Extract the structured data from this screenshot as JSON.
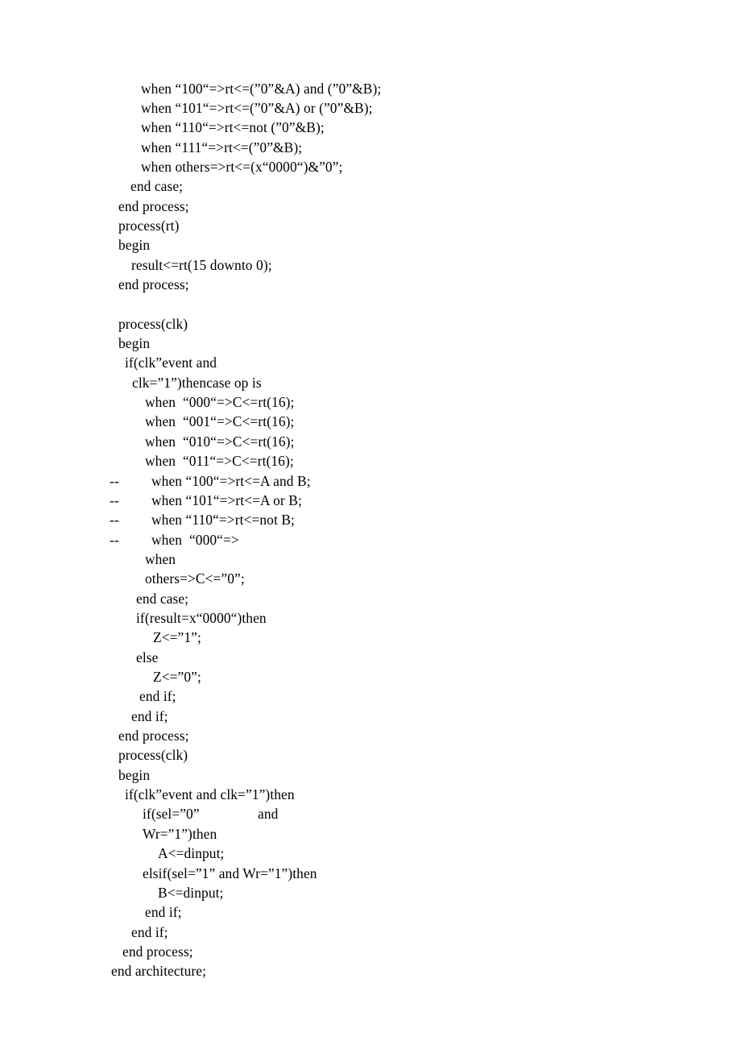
{
  "document": {
    "type": "vhdl-source-listing",
    "page_background": "#ffffff",
    "text_color": "#000000",
    "lines": [
      {
        "indent": 175,
        "text": "when “100“=>rt<=(”0”&A) and (”0”&B);"
      },
      {
        "indent": 175,
        "text": "when “101“=>rt<=(”0”&A) or (”0”&B);"
      },
      {
        "indent": 175,
        "text": "when “110“=>rt<=not (”0”&B);"
      },
      {
        "indent": 175,
        "text": "when “111“=>rt<=(”0”&B);"
      },
      {
        "indent": 175,
        "text": "when others=>rt<=(x“0000“)&”0”;"
      },
      {
        "indent": 162,
        "text": "end case;"
      },
      {
        "indent": 147,
        "text": "end process;"
      },
      {
        "indent": 147,
        "text": "process(rt)"
      },
      {
        "indent": 147,
        "text": "begin"
      },
      {
        "indent": 163,
        "text": "result<=rt(15 downto 0);"
      },
      {
        "indent": 147,
        "text": "end process;"
      },
      {
        "blank": true
      },
      {
        "indent": 147,
        "text": "process(clk)"
      },
      {
        "indent": 147,
        "text": "begin"
      },
      {
        "indent": 155,
        "text": "if(clk”event and"
      },
      {
        "indent": 164,
        "text": "clk=”1”)thencase op is"
      },
      {
        "indent": 180,
        "text": "when  “000“=>C<=rt(16);"
      },
      {
        "indent": 180,
        "text": "when  “001“=>C<=rt(16);"
      },
      {
        "indent": 180,
        "text": "when  “010“=>C<=rt(16);"
      },
      {
        "indent": 180,
        "text": "when  “011“=>C<=rt(16);"
      },
      {
        "comment": "--",
        "indent": 188,
        "text": "when “100“=>rt<=A and B;"
      },
      {
        "comment": "--",
        "indent": 188,
        "text": "when “101“=>rt<=A or B;"
      },
      {
        "comment": "--",
        "indent": 188,
        "text": "when “110“=>rt<=not B;"
      },
      {
        "comment": "--",
        "indent": 188,
        "text": "when  “000“=>"
      },
      {
        "indent": 180,
        "text": "when"
      },
      {
        "indent": 180,
        "text": "others=>C<=”0”;"
      },
      {
        "indent": 169,
        "text": "end case;"
      },
      {
        "indent": 169,
        "text": "if(result=x“0000“)then"
      },
      {
        "indent": 190,
        "text": "Z<=”1”;"
      },
      {
        "indent": 169,
        "text": "else"
      },
      {
        "indent": 190,
        "text": "Z<=”0”;"
      },
      {
        "indent": 173,
        "text": "end if;"
      },
      {
        "indent": 163,
        "text": "end if;"
      },
      {
        "indent": 147,
        "text": "end process;"
      },
      {
        "indent": 147,
        "text": "process(clk)"
      },
      {
        "indent": 147,
        "text": "begin"
      },
      {
        "indent": 155,
        "text": "if(clk”event and clk=”1”)then"
      },
      {
        "indent": 177,
        "text": "if(sel=”0”",
        "trailing": "and",
        "trailing_indent": 320
      },
      {
        "indent": 177,
        "text": "Wr=”1”)then"
      },
      {
        "indent": 196,
        "text": "A<=dinput;"
      },
      {
        "indent": 177,
        "text": "elsif(sel=”1” and Wr=”1”)then"
      },
      {
        "indent": 196,
        "text": "B<=dinput;"
      },
      {
        "indent": 180,
        "text": "end if;"
      },
      {
        "indent": 163,
        "text": "end if;"
      },
      {
        "indent": 152,
        "text": "end process;"
      },
      {
        "indent": 138,
        "text": "end architecture;"
      }
    ]
  }
}
